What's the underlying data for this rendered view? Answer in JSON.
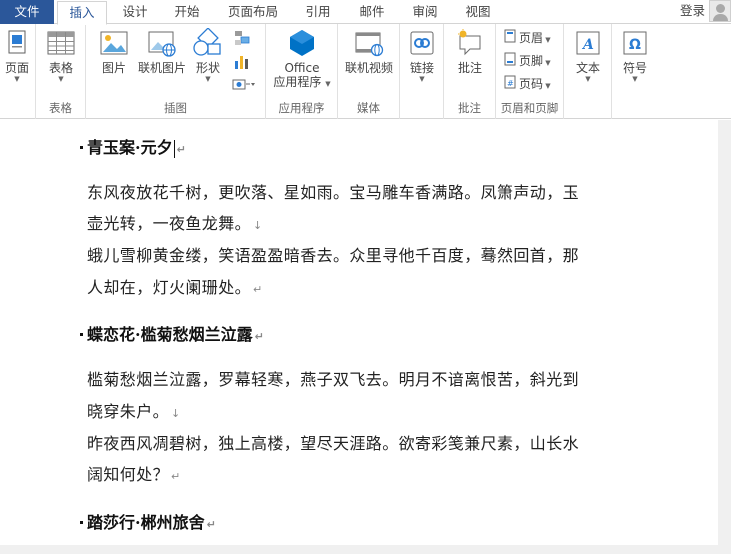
{
  "tabs": {
    "file": "文件",
    "items": [
      "插入",
      "设计",
      "开始",
      "页面布局",
      "引用",
      "邮件",
      "审阅",
      "视图"
    ],
    "active_index": 0,
    "login": "登录"
  },
  "ribbon": {
    "page_btn": "页面",
    "table_btn": "表格",
    "table_group": "表格",
    "picture_btn": "图片",
    "online_picture_btn": "联机图片",
    "shapes_btn": "形状",
    "illustrations_group": "插图",
    "office_apps_line1": "Office",
    "office_apps_line2": "应用程序",
    "apps_group": "应用程序",
    "online_video_btn": "联机视频",
    "media_group": "媒体",
    "link_btn": "链接",
    "comment_btn": "批注",
    "comment_group": "批注",
    "header_btn": "页眉",
    "footer_btn": "页脚",
    "page_number_btn": "页码",
    "header_footer_group": "页眉和页脚",
    "text_btn": "文本",
    "symbol_btn": "符号"
  },
  "document": {
    "heading1": "青玉案·元夕",
    "p1_line1": "东风夜放花千树，更吹落、星如雨。宝马雕车香满路。凤箫声动，玉",
    "p1_line2": "壶光转，一夜鱼龙舞。",
    "p2_line1": "蛾儿雪柳黄金缕，笑语盈盈暗香去。众里寻他千百度，蓦然回首，那",
    "p2_line2": "人却在，灯火阑珊处。",
    "heading2": "蝶恋花·槛菊愁烟兰泣露",
    "p3_line1": "槛菊愁烟兰泣露，罗幕轻寒，燕子双飞去。明月不谙离恨苦，斜光到",
    "p3_line2": "晓穿朱户。",
    "p4_line1": "昨夜西风凋碧树，独上高楼，望尽天涯路。欲寄彩笺兼尺素，山长水",
    "p4_line2": "阔知何处？",
    "heading3": "踏莎行·郴州旅舍",
    "para_mark": "↵",
    "line_break_mark": "↓"
  },
  "colors": {
    "accent": "#2b579a",
    "office_blue": "#0072c6"
  }
}
